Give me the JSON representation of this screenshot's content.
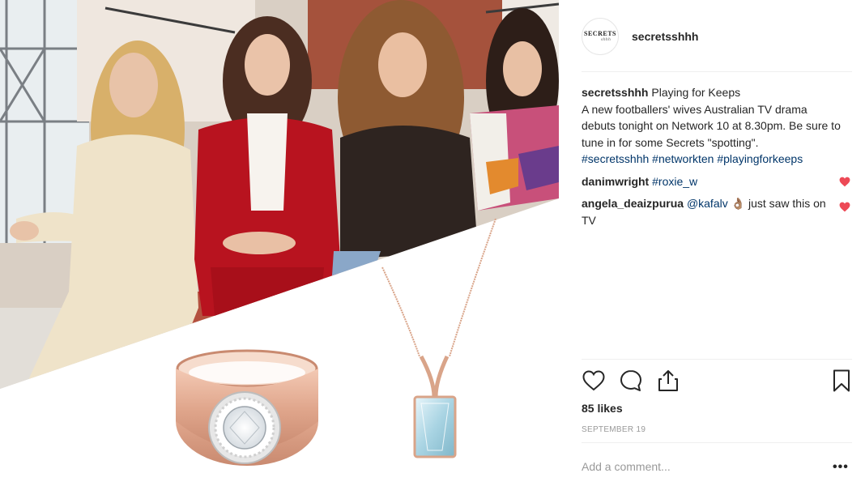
{
  "post": {
    "username": "secretsshhh",
    "avatar_text_main": "SECRETS",
    "avatar_text_sub": "shhh",
    "caption": {
      "username": "secretsshhh",
      "lines": [
        "Playing for Keeps",
        "A new footballers' wives Australian TV drama debuts tonight on Network 10 at 8.30pm. Be sure to tune in for some Secrets \"spotting\"."
      ],
      "hashtags": [
        "#secretsshhh",
        "#networkten",
        "#playingforkeeps"
      ]
    },
    "comments": [
      {
        "username": "danimwright",
        "text": "#roxie_w"
      },
      {
        "username": "angela_deaizpurua",
        "mention": "@kafalv",
        "emoji": "👌🏽",
        "text": "just saw this on TV"
      }
    ],
    "likes": "85 likes",
    "date": "SEPTEMBER 19",
    "add_comment_placeholder": "Add a comment...",
    "more_options": "•••"
  },
  "icons": {
    "like": "heart-outline-icon",
    "comment": "speech-bubble-icon",
    "share": "share-icon",
    "save": "bookmark-icon",
    "comment_like": "heart-filled-icon"
  },
  "colors": {
    "link": "#003569",
    "heart": "#ed4956",
    "muted": "#999999",
    "rose_gold": "#d9a489"
  }
}
